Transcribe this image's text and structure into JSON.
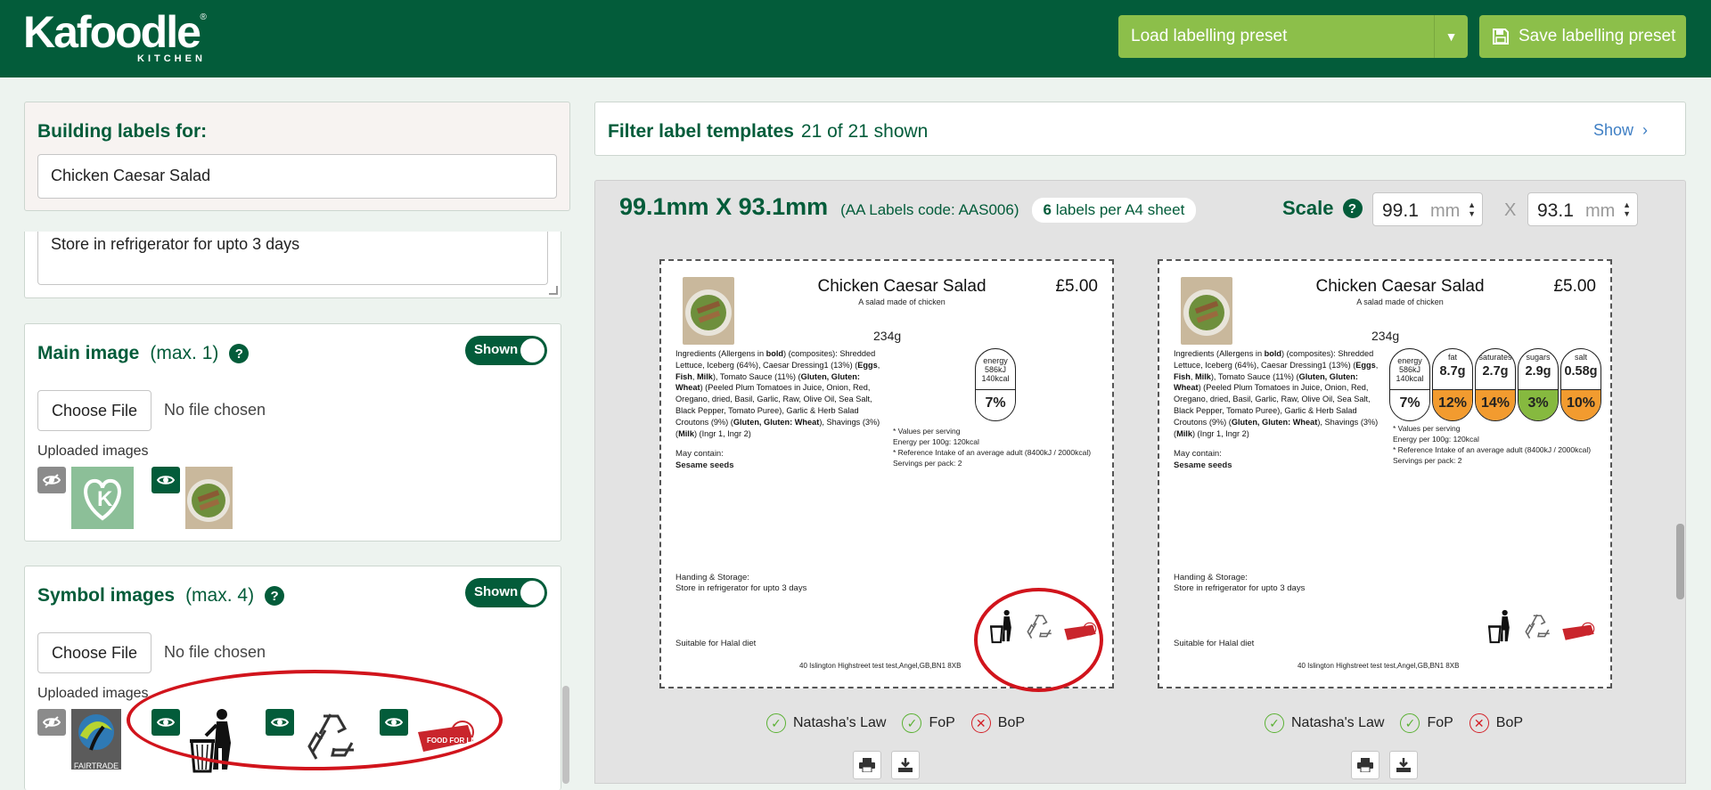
{
  "header": {
    "logo_text": "Kafoodle",
    "logo_sub": "KITCHEN",
    "logo_reg": "®",
    "load_preset": "Load labelling preset",
    "save_preset": "Save labelling preset"
  },
  "building": {
    "title": "Building labels for:",
    "value": "Chicken Caesar Salad"
  },
  "storage": {
    "value": "Store in refrigerator for upto 3 days"
  },
  "main_image": {
    "title": "Main image",
    "max": "(max. 1)",
    "toggle": "Shown",
    "choose": "Choose File",
    "no_file": "No file chosen",
    "uploaded": "Uploaded images"
  },
  "symbol_images": {
    "title": "Symbol images",
    "max": "(max. 4)",
    "toggle": "Shown",
    "choose": "Choose File",
    "no_file": "No file chosen",
    "uploaded": "Uploaded images",
    "fairtrade": "FAIRTRADE"
  },
  "filter": {
    "title": "Filter label templates",
    "count": "21 of 21 shown",
    "show": "Show"
  },
  "template": {
    "dims": "99.1mm X 93.1mm",
    "code": "(AA Labels code: AAS006)",
    "per_sheet_num": "6",
    "per_sheet_text": "labels per A4 sheet",
    "scale_label": "Scale",
    "width": "99.1",
    "height": "93.1",
    "unit": "mm",
    "x": "X"
  },
  "label": {
    "name": "Chicken Caesar Salad",
    "desc": "A salad made of chicken",
    "price": "£5.00",
    "weight": "234g",
    "ingr_1": "Ingredients (Allergens in ",
    "ingr_bold": "bold",
    "ingr_2": ") (composites): Shredded Lettuce, Iceberg (64%), Caesar Dressing1 (13%) (",
    "ingr_a1": "Eggs",
    "ingr_a2": "Fish",
    "ingr_a3": "Milk",
    "ingr_3": "), Tomato Sauce (11%) (",
    "ingr_a4": "Gluten, Gluten: Wheat",
    "ingr_4": ") (Peeled Plum Tomatoes in Juice, Onion, Red, Oregano, dried, Basil, Garlic, Raw, Olive Oil, Sea Salt, Black Pepper, Tomato Puree), Garlic & Herb Salad Croutons (9%) (",
    "ingr_a5": "Gluten, Gluten: Wheat",
    "ingr_5": "), Shavings (3%) (",
    "ingr_a6": "Milk",
    "ingr_6": ") (Ingr 1, Ingr 2)",
    "may_contain": "May contain:",
    "allergen": "Sesame seeds",
    "handling": "Handing & Storage:",
    "storage": "Store in refrigerator for upto 3 days",
    "halal": "Suitable for Halal diet",
    "address": "40 Islington Highstreet test test,Angel,GB,BN1 8XB",
    "note1": "* Values per serving",
    "note2": "Energy per 100g: 120kcal",
    "note3": "* Reference Intake of an average adult (8400kJ / 2000kcal)",
    "note4": "Servings per pack: 2",
    "energy_label": "energy",
    "energy_kj": "586kJ",
    "energy_kcal": "140kcal",
    "energy_pct": "7%",
    "fat_label": "fat",
    "fat_val": "8.7g",
    "fat_pct": "12%",
    "sat_label": "saturates",
    "sat_val": "2.7g",
    "sat_pct": "14%",
    "sug_label": "sugars",
    "sug_val": "2.9g",
    "sug_pct": "3%",
    "salt_label": "salt",
    "salt_val": "0.58g",
    "salt_pct": "10%",
    "soil_text": "Soil Association FOOD FOR LIFE CATERING MARK"
  },
  "checks": {
    "natasha": "Natasha's Law",
    "fop": "FoP",
    "bop": "BoP"
  },
  "colors": {
    "brand": "#035c3a",
    "accent": "#8cbf4a",
    "highlight": "#d1141c"
  }
}
